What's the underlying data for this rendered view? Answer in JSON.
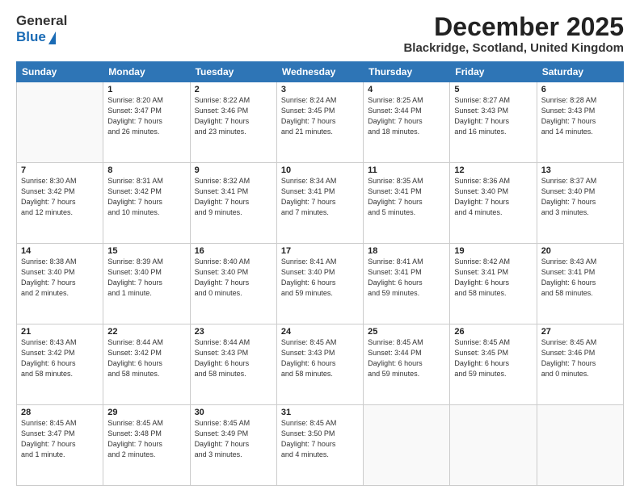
{
  "header": {
    "logo_line1": "General",
    "logo_line2": "Blue",
    "month_title": "December 2025",
    "location": "Blackridge, Scotland, United Kingdom"
  },
  "weekdays": [
    "Sunday",
    "Monday",
    "Tuesday",
    "Wednesday",
    "Thursday",
    "Friday",
    "Saturday"
  ],
  "weeks": [
    [
      {
        "day": "",
        "info": ""
      },
      {
        "day": "1",
        "info": "Sunrise: 8:20 AM\nSunset: 3:47 PM\nDaylight: 7 hours\nand 26 minutes."
      },
      {
        "day": "2",
        "info": "Sunrise: 8:22 AM\nSunset: 3:46 PM\nDaylight: 7 hours\nand 23 minutes."
      },
      {
        "day": "3",
        "info": "Sunrise: 8:24 AM\nSunset: 3:45 PM\nDaylight: 7 hours\nand 21 minutes."
      },
      {
        "day": "4",
        "info": "Sunrise: 8:25 AM\nSunset: 3:44 PM\nDaylight: 7 hours\nand 18 minutes."
      },
      {
        "day": "5",
        "info": "Sunrise: 8:27 AM\nSunset: 3:43 PM\nDaylight: 7 hours\nand 16 minutes."
      },
      {
        "day": "6",
        "info": "Sunrise: 8:28 AM\nSunset: 3:43 PM\nDaylight: 7 hours\nand 14 minutes."
      }
    ],
    [
      {
        "day": "7",
        "info": "Sunrise: 8:30 AM\nSunset: 3:42 PM\nDaylight: 7 hours\nand 12 minutes."
      },
      {
        "day": "8",
        "info": "Sunrise: 8:31 AM\nSunset: 3:42 PM\nDaylight: 7 hours\nand 10 minutes."
      },
      {
        "day": "9",
        "info": "Sunrise: 8:32 AM\nSunset: 3:41 PM\nDaylight: 7 hours\nand 9 minutes."
      },
      {
        "day": "10",
        "info": "Sunrise: 8:34 AM\nSunset: 3:41 PM\nDaylight: 7 hours\nand 7 minutes."
      },
      {
        "day": "11",
        "info": "Sunrise: 8:35 AM\nSunset: 3:41 PM\nDaylight: 7 hours\nand 5 minutes."
      },
      {
        "day": "12",
        "info": "Sunrise: 8:36 AM\nSunset: 3:40 PM\nDaylight: 7 hours\nand 4 minutes."
      },
      {
        "day": "13",
        "info": "Sunrise: 8:37 AM\nSunset: 3:40 PM\nDaylight: 7 hours\nand 3 minutes."
      }
    ],
    [
      {
        "day": "14",
        "info": "Sunrise: 8:38 AM\nSunset: 3:40 PM\nDaylight: 7 hours\nand 2 minutes."
      },
      {
        "day": "15",
        "info": "Sunrise: 8:39 AM\nSunset: 3:40 PM\nDaylight: 7 hours\nand 1 minute."
      },
      {
        "day": "16",
        "info": "Sunrise: 8:40 AM\nSunset: 3:40 PM\nDaylight: 7 hours\nand 0 minutes."
      },
      {
        "day": "17",
        "info": "Sunrise: 8:41 AM\nSunset: 3:40 PM\nDaylight: 6 hours\nand 59 minutes."
      },
      {
        "day": "18",
        "info": "Sunrise: 8:41 AM\nSunset: 3:41 PM\nDaylight: 6 hours\nand 59 minutes."
      },
      {
        "day": "19",
        "info": "Sunrise: 8:42 AM\nSunset: 3:41 PM\nDaylight: 6 hours\nand 58 minutes."
      },
      {
        "day": "20",
        "info": "Sunrise: 8:43 AM\nSunset: 3:41 PM\nDaylight: 6 hours\nand 58 minutes."
      }
    ],
    [
      {
        "day": "21",
        "info": "Sunrise: 8:43 AM\nSunset: 3:42 PM\nDaylight: 6 hours\nand 58 minutes."
      },
      {
        "day": "22",
        "info": "Sunrise: 8:44 AM\nSunset: 3:42 PM\nDaylight: 6 hours\nand 58 minutes."
      },
      {
        "day": "23",
        "info": "Sunrise: 8:44 AM\nSunset: 3:43 PM\nDaylight: 6 hours\nand 58 minutes."
      },
      {
        "day": "24",
        "info": "Sunrise: 8:45 AM\nSunset: 3:43 PM\nDaylight: 6 hours\nand 58 minutes."
      },
      {
        "day": "25",
        "info": "Sunrise: 8:45 AM\nSunset: 3:44 PM\nDaylight: 6 hours\nand 59 minutes."
      },
      {
        "day": "26",
        "info": "Sunrise: 8:45 AM\nSunset: 3:45 PM\nDaylight: 6 hours\nand 59 minutes."
      },
      {
        "day": "27",
        "info": "Sunrise: 8:45 AM\nSunset: 3:46 PM\nDaylight: 7 hours\nand 0 minutes."
      }
    ],
    [
      {
        "day": "28",
        "info": "Sunrise: 8:45 AM\nSunset: 3:47 PM\nDaylight: 7 hours\nand 1 minute."
      },
      {
        "day": "29",
        "info": "Sunrise: 8:45 AM\nSunset: 3:48 PM\nDaylight: 7 hours\nand 2 minutes."
      },
      {
        "day": "30",
        "info": "Sunrise: 8:45 AM\nSunset: 3:49 PM\nDaylight: 7 hours\nand 3 minutes."
      },
      {
        "day": "31",
        "info": "Sunrise: 8:45 AM\nSunset: 3:50 PM\nDaylight: 7 hours\nand 4 minutes."
      },
      {
        "day": "",
        "info": ""
      },
      {
        "day": "",
        "info": ""
      },
      {
        "day": "",
        "info": ""
      }
    ]
  ]
}
